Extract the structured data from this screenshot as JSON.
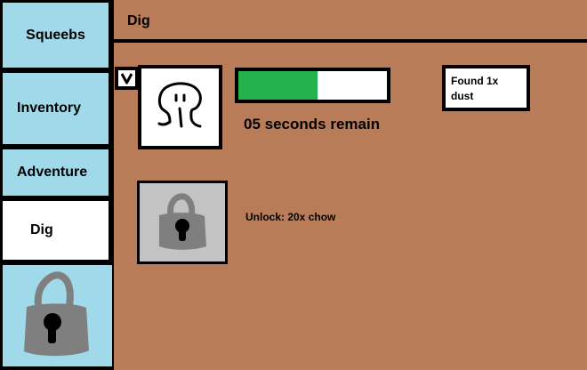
{
  "colors": {
    "background": "#b87d58",
    "nav_bg": "#9fd9ea",
    "nav_active_bg": "#ffffff",
    "progress_fill": "#22b14c",
    "lock_gray": "#7f7f7f"
  },
  "sidebar": {
    "items": [
      {
        "label": "Squeebs"
      },
      {
        "label": "Inventory"
      },
      {
        "label": "Adventure"
      },
      {
        "label": "Dig",
        "active": true
      },
      {
        "label": "",
        "icon": "lock-icon",
        "locked": true
      }
    ]
  },
  "header": {
    "title": "Dig"
  },
  "dig": {
    "collapse_icon": "chevron-down-icon",
    "creature_icon": "squeeb-creature-icon",
    "progress_percent": 53,
    "countdown": "05 seconds remain",
    "found_line1": "Found 1x",
    "found_line2": "dust",
    "locked_slot": {
      "icon": "lock-icon",
      "unlock_text": "Unlock: 20x chow"
    }
  }
}
